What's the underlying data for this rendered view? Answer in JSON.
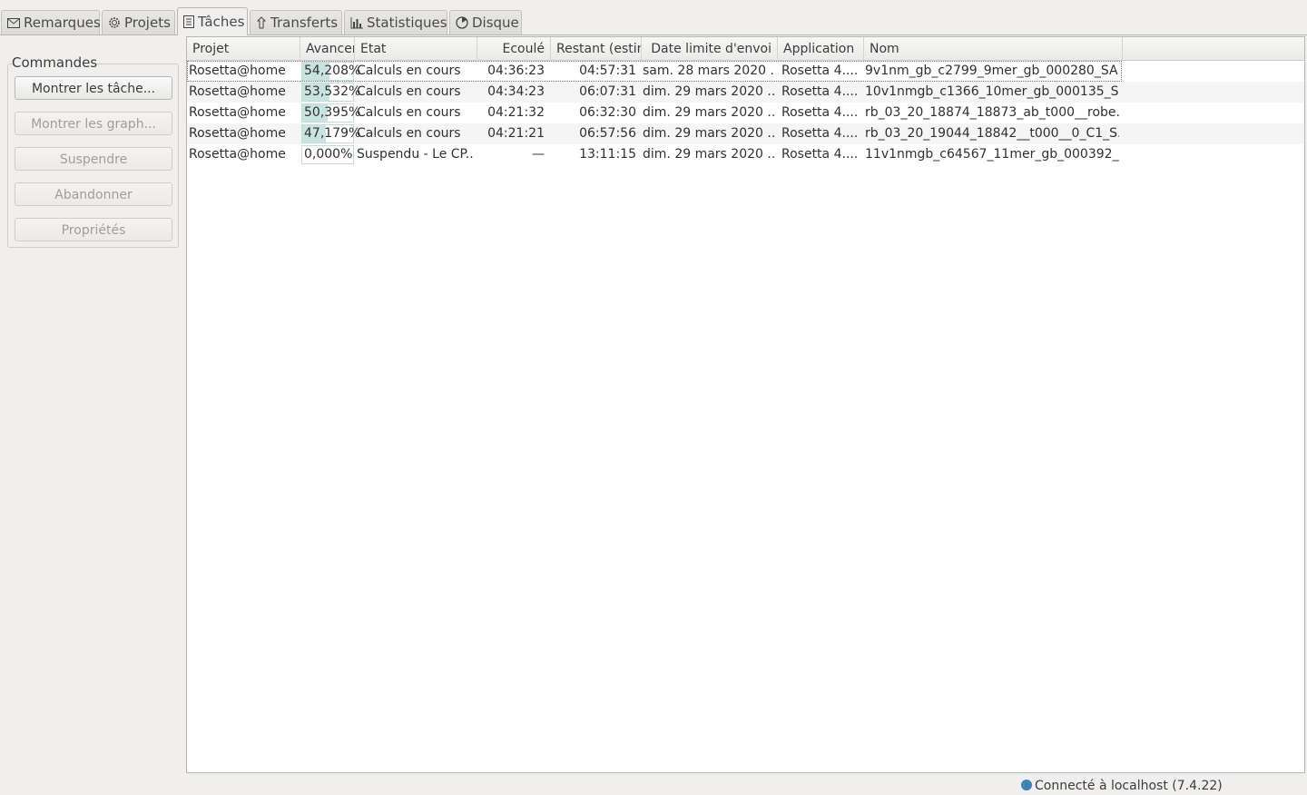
{
  "tabs": [
    {
      "label": "Remarques",
      "icon": "envelope-icon"
    },
    {
      "label": "Projets",
      "icon": "gear-icon"
    },
    {
      "label": "Tâches",
      "icon": "document-icon"
    },
    {
      "label": "Transferts",
      "icon": "transfer-icon"
    },
    {
      "label": "Statistiques",
      "icon": "bar-chart-icon"
    },
    {
      "label": "Disque",
      "icon": "disk-icon"
    }
  ],
  "active_tab": "Tâches",
  "commands": {
    "title": "Commandes",
    "buttons": [
      {
        "label": "Montrer les tâche...",
        "enabled": true
      },
      {
        "label": "Montrer les graph...",
        "enabled": false
      },
      {
        "label": "Suspendre",
        "enabled": false
      },
      {
        "label": "Abandonner",
        "enabled": false
      },
      {
        "label": "Propriétés",
        "enabled": false
      }
    ]
  },
  "table": {
    "columns": [
      "Projet",
      "Avancer",
      "Etat",
      "Ecoulé",
      "Restant (estin",
      "Date limite d'envoi",
      "Application",
      "Nom"
    ],
    "rows": [
      {
        "projet": "Rosetta@home",
        "progress": "54,208%",
        "progress_value": 54.208,
        "etat": "Calculs en cours",
        "ecoule": "04:36:23",
        "restant": "04:57:31",
        "date": "sam. 28 mars 2020 ...",
        "application": "Rosetta 4....",
        "nom": "9v1nm_gb_c2799_9mer_gb_000280_SA..."
      },
      {
        "projet": "Rosetta@home",
        "progress": "53,532%",
        "progress_value": 53.532,
        "etat": "Calculs en cours",
        "ecoule": "04:34:23",
        "restant": "06:07:31",
        "date": "dim. 29 mars 2020 ...",
        "application": "Rosetta 4....",
        "nom": "10v1nmgb_c1366_10mer_gb_000135_S..."
      },
      {
        "projet": "Rosetta@home",
        "progress": "50,395%",
        "progress_value": 50.395,
        "etat": "Calculs en cours",
        "ecoule": "04:21:32",
        "restant": "06:32:30",
        "date": "dim. 29 mars 2020 ...",
        "application": "Rosetta 4....",
        "nom": "rb_03_20_18874_18873_ab_t000__robe..."
      },
      {
        "projet": "Rosetta@home",
        "progress": "47,179%",
        "progress_value": 47.179,
        "etat": "Calculs en cours",
        "ecoule": "04:21:21",
        "restant": "06:57:56",
        "date": "dim. 29 mars 2020 ...",
        "application": "Rosetta 4....",
        "nom": "rb_03_20_19044_18842__t000__0_C1_S..."
      },
      {
        "projet": "Rosetta@home",
        "progress": "0,000%",
        "progress_value": 0,
        "etat": "Suspendu - Le CP...",
        "ecoule": "—",
        "restant": "13:11:15",
        "date": "dim. 29 mars 2020 ...",
        "application": "Rosetta 4....",
        "nom": "11v1nmgb_c64567_11mer_gb_000392_..."
      }
    ]
  },
  "status": {
    "text": "Connecté à localhost (7.4.22)",
    "icon": "globe-icon"
  },
  "colors": {
    "progress_fill": "#c9e3e0",
    "progress_border": "#c5dcd8"
  }
}
